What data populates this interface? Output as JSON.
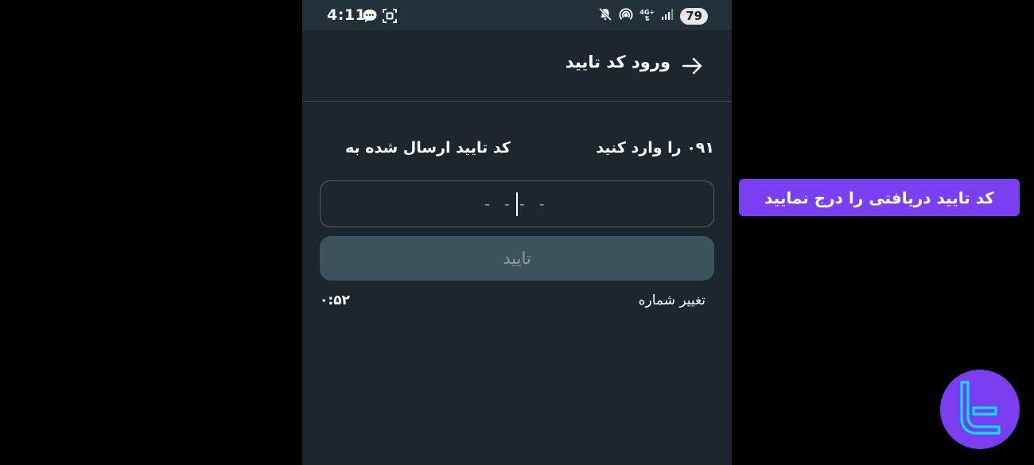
{
  "status_bar": {
    "time": "4:11",
    "network": "4G+",
    "battery": "79"
  },
  "header": {
    "title": "ورود کد تایید"
  },
  "instruction": {
    "text_start": "کد تایید ارسال شده به",
    "text_end": "۰۹۱ را وارد کنید"
  },
  "code_input": {
    "placeholder_left": "- -",
    "placeholder_right": "- -"
  },
  "confirm_button": {
    "label": "تایید"
  },
  "footer": {
    "change_number": "تغییر شماره",
    "timer": "۰:۵۲"
  },
  "callout": {
    "text": "کد تایید دریافتی را درج نمایید"
  },
  "colors": {
    "app_background": "#1d262d",
    "status_bar": "#22303a",
    "button_disabled": "#3c525d",
    "callout_accent": "#7b3ff2",
    "logo_accent": "#00e5ff"
  }
}
